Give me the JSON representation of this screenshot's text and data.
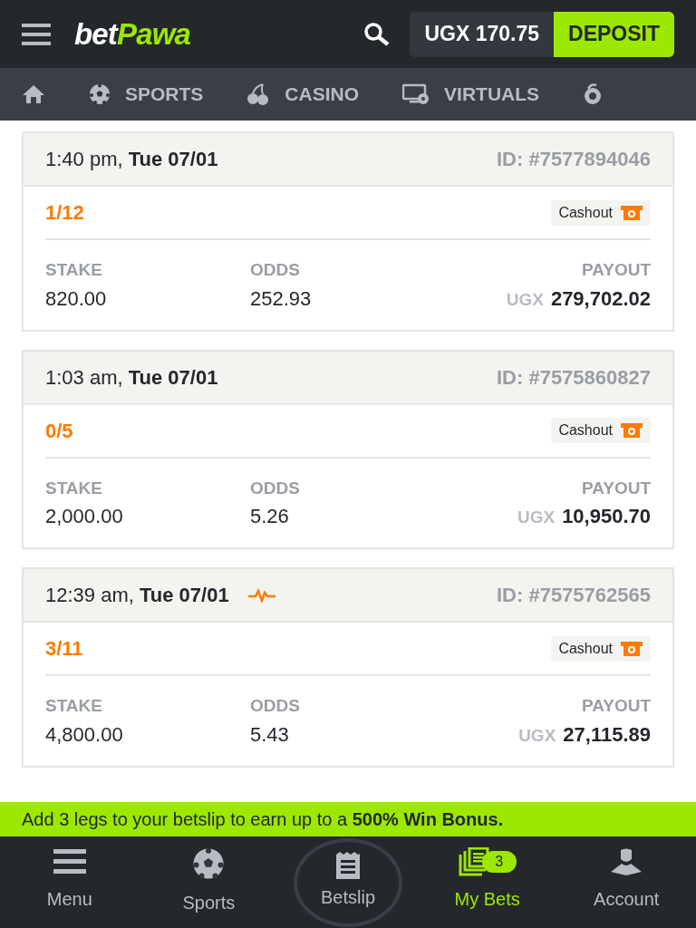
{
  "header": {
    "logo": {
      "part_1": "bet",
      "part_2": "Pawa"
    },
    "balance": "UGX 170.75",
    "deposit": "DEPOSIT"
  },
  "nav": [
    {
      "kind": "home"
    },
    {
      "kind": "sports",
      "label": "SPORTS"
    },
    {
      "kind": "casino",
      "label": "CASINO"
    },
    {
      "kind": "virtuals",
      "label": "VIRTUALS"
    },
    {
      "kind": "more"
    }
  ],
  "bets": [
    {
      "time": "1:40 pm,",
      "date": "Tue 07/01",
      "live": false,
      "id": "ID: #7577894046",
      "legs": "1/12",
      "cashout": "Cashout",
      "stake_label": "STAKE",
      "stake": "820.00",
      "odds_label": "ODDS",
      "odds": "252.93",
      "payout_label": "PAYOUT",
      "currency": "UGX",
      "payout": "279,702.02"
    },
    {
      "time": "1:03 am,",
      "date": "Tue 07/01",
      "live": false,
      "id": "ID: #7575860827",
      "legs": "0/5",
      "cashout": "Cashout",
      "stake_label": "STAKE",
      "stake": "2,000.00",
      "odds_label": "ODDS",
      "odds": "5.26",
      "payout_label": "PAYOUT",
      "currency": "UGX",
      "payout": "10,950.70"
    },
    {
      "time": "12:39 am,",
      "date": "Tue 07/01",
      "live": true,
      "id": "ID: #7575762565",
      "legs": "3/11",
      "cashout": "Cashout",
      "stake_label": "STAKE",
      "stake": "4,800.00",
      "odds_label": "ODDS",
      "odds": "5.43",
      "payout_label": "PAYOUT",
      "currency": "UGX",
      "payout": "27,115.89"
    }
  ],
  "banner": "Add 3 legs to your betslip to earn up to a **500% Win Bonus.**",
  "bottom_nav": [
    {
      "kind": "menu",
      "label": "Menu",
      "selected": false
    },
    {
      "kind": "sports",
      "label": "Sports",
      "selected": false
    },
    {
      "kind": "betslip",
      "label": "Betslip",
      "selected": false
    },
    {
      "kind": "mybets",
      "label": "My Bets",
      "selected": true,
      "badge": "3"
    },
    {
      "kind": "account",
      "label": "Account",
      "selected": false
    }
  ]
}
